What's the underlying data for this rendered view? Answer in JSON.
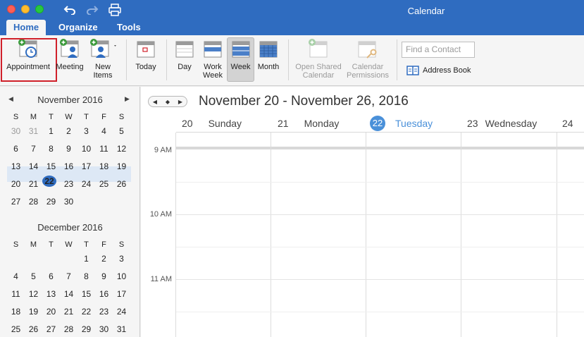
{
  "window": {
    "title": "Calendar",
    "tabs": [
      {
        "label": "Home",
        "active": true
      },
      {
        "label": "Organize",
        "active": false
      },
      {
        "label": "Tools",
        "active": false
      }
    ]
  },
  "ribbon": {
    "appointment": "Appointment",
    "meeting": "Meeting",
    "new_items_line1": "New",
    "new_items_line2": "Items",
    "today": "Today",
    "day": "Day",
    "work_week_line1": "Work",
    "work_week_line2": "Week",
    "week": "Week",
    "month": "Month",
    "open_shared_line1": "Open Shared",
    "open_shared_line2": "Calendar",
    "cal_perm_line1": "Calendar",
    "cal_perm_line2": "Permissions",
    "find_contact_placeholder": "Find a Contact",
    "address_book": "Address Book"
  },
  "mini_calendars": [
    {
      "title": "November 2016",
      "weekday_headers": [
        "S",
        "M",
        "T",
        "W",
        "T",
        "F",
        "S"
      ],
      "weeks": [
        [
          {
            "d": "30",
            "other": true
          },
          {
            "d": "31",
            "other": true
          },
          {
            "d": "1"
          },
          {
            "d": "2"
          },
          {
            "d": "3"
          },
          {
            "d": "4"
          },
          {
            "d": "5"
          }
        ],
        [
          {
            "d": "6"
          },
          {
            "d": "7"
          },
          {
            "d": "8"
          },
          {
            "d": "9"
          },
          {
            "d": "10"
          },
          {
            "d": "11"
          },
          {
            "d": "12"
          }
        ],
        [
          {
            "d": "13"
          },
          {
            "d": "14"
          },
          {
            "d": "15"
          },
          {
            "d": "16"
          },
          {
            "d": "17"
          },
          {
            "d": "18"
          },
          {
            "d": "19"
          }
        ],
        [
          {
            "d": "20"
          },
          {
            "d": "21"
          },
          {
            "d": "22",
            "today": true
          },
          {
            "d": "23"
          },
          {
            "d": "24"
          },
          {
            "d": "25"
          },
          {
            "d": "26"
          }
        ],
        [
          {
            "d": "27"
          },
          {
            "d": "28"
          },
          {
            "d": "29"
          },
          {
            "d": "30"
          }
        ]
      ]
    },
    {
      "title": "December 2016",
      "weekday_headers": [
        "S",
        "M",
        "T",
        "W",
        "T",
        "F",
        "S"
      ],
      "weeks": [
        [
          {
            "d": ""
          },
          {
            "d": ""
          },
          {
            "d": ""
          },
          {
            "d": ""
          },
          {
            "d": "1"
          },
          {
            "d": "2"
          },
          {
            "d": "3"
          }
        ],
        [
          {
            "d": "4"
          },
          {
            "d": "5"
          },
          {
            "d": "6"
          },
          {
            "d": "7"
          },
          {
            "d": "8"
          },
          {
            "d": "9"
          },
          {
            "d": "10"
          }
        ],
        [
          {
            "d": "11"
          },
          {
            "d": "12"
          },
          {
            "d": "13"
          },
          {
            "d": "14"
          },
          {
            "d": "15"
          },
          {
            "d": "16"
          },
          {
            "d": "17"
          }
        ],
        [
          {
            "d": "18"
          },
          {
            "d": "19"
          },
          {
            "d": "20"
          },
          {
            "d": "21"
          },
          {
            "d": "22"
          },
          {
            "d": "23"
          },
          {
            "d": "24"
          }
        ],
        [
          {
            "d": "25"
          },
          {
            "d": "26"
          },
          {
            "d": "27"
          },
          {
            "d": "28"
          },
          {
            "d": "29"
          },
          {
            "d": "30"
          },
          {
            "d": "31"
          }
        ]
      ]
    }
  ],
  "calendar": {
    "range_title": "November 20 - November 26, 2016",
    "days": [
      {
        "num": "20",
        "name": "Sunday"
      },
      {
        "num": "21",
        "name": "Monday"
      },
      {
        "num": "22",
        "name": "Tuesday",
        "today": true
      },
      {
        "num": "23",
        "name": "Wednesday"
      },
      {
        "num": "24",
        "name": ""
      }
    ],
    "time_labels": [
      "9 AM",
      "10 AM",
      "11 AM"
    ]
  },
  "colors": {
    "brand_blue": "#2f6cc0",
    "today_blue": "#4a90d9",
    "highlight_red": "#d0202a"
  }
}
